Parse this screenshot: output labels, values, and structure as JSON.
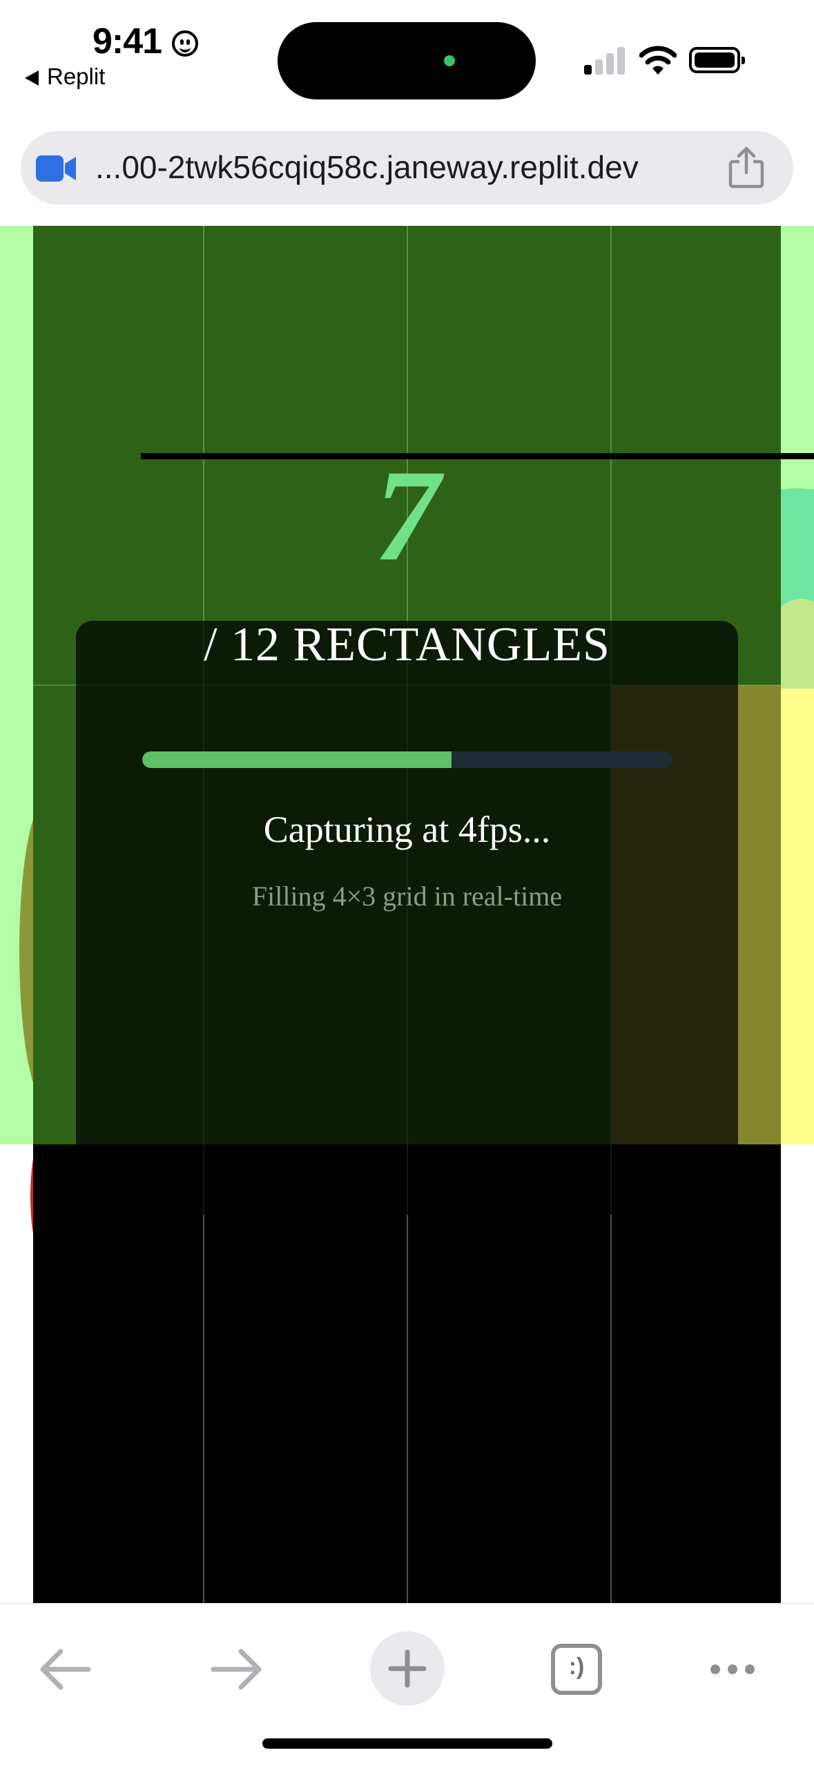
{
  "status_bar": {
    "time": "9:41",
    "back_app": "Replit",
    "icons": [
      "smiley-icon",
      "cellular-signal-icon",
      "wifi-icon",
      "battery-icon"
    ]
  },
  "browser": {
    "url": "...00-2twk56cqiq58c.janeway.replit.dev",
    "site_icon": "video-camera-icon",
    "share_icon": "share-icon"
  },
  "overlay": {
    "count": "7",
    "count_label": "/ 12 RECTANGLES",
    "progress_fraction": 0.583,
    "capturing_text": "Capturing at 4fps...",
    "sub_text": "Filling 4×3 grid in real-time"
  },
  "grid": {
    "columns": 4,
    "rows": 3,
    "filled": 7,
    "colors": {
      "filled": "#2d6217",
      "empty": "#000000",
      "accent": "#72e088",
      "side": "#b3fda4",
      "yellow": "#fefe8c"
    }
  },
  "toolbar": {
    "buttons": [
      "back-arrow-icon",
      "forward-arrow-icon",
      "plus-icon",
      "tabs-icon",
      "more-icon"
    ],
    "tabs_label": ":)"
  }
}
